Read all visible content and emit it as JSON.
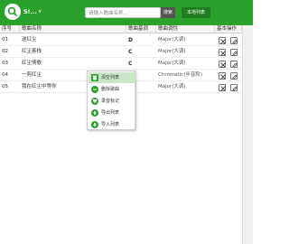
{
  "header": {
    "title": "5!...",
    "chevron": "∨",
    "search_placeholder": "请输入歌曲名称...",
    "search_button": "搜索",
    "local_button": "本地列表",
    "brand_color": "#2aa12a"
  },
  "columns": [
    "序号",
    "歌曲名称",
    "歌曲基调",
    "歌曲调性",
    "基本操作"
  ],
  "rows": [
    {
      "index": "01",
      "name": "送红尘",
      "key": "D",
      "mode": "Major(大调)"
    },
    {
      "index": "02",
      "name": "红尘客栈",
      "key": "C",
      "mode": "Major(大调)"
    },
    {
      "index": "03",
      "name": "红尘情歌",
      "key": "C",
      "mode": "Major(大调)"
    },
    {
      "index": "04",
      "name": "一剪红尘",
      "key": "C",
      "mode": "Chromatic(半音阶)"
    },
    {
      "index": "05",
      "name": "我在红尘中等你",
      "key": "C",
      "mode": "Major(大调)"
    }
  ],
  "context_menu": {
    "items": [
      {
        "label": "清空列表",
        "icon": "trash-icon"
      },
      {
        "label": "删除歌曲",
        "icon": "minus-circle-icon"
      },
      {
        "label": "录音标记",
        "icon": "heart-icon"
      },
      {
        "label": "导出列表",
        "icon": "export-icon"
      },
      {
        "label": "导入列表",
        "icon": "import-icon"
      }
    ]
  },
  "row_actions": {
    "delete_icon": "close-icon",
    "edit_icon": "edit-icon"
  }
}
